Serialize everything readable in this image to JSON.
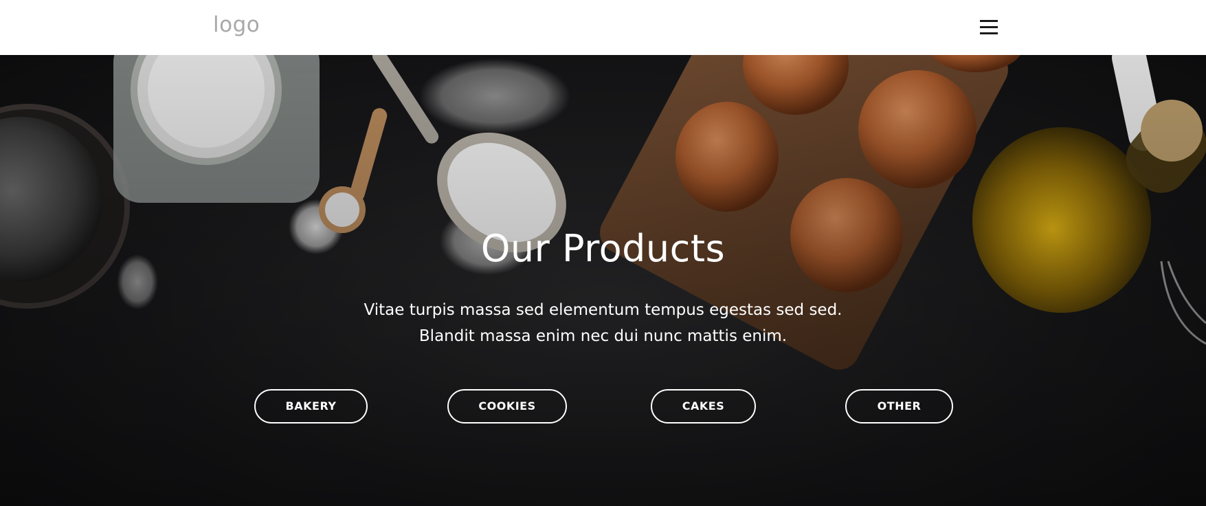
{
  "header": {
    "logo_text": "logo",
    "menu_icon": "hamburger-menu-icon"
  },
  "hero": {
    "title": "Our Products",
    "text_line_1": "Vitae turpis massa sed elementum tempus egestas sed sed.",
    "text_line_2": "Blandit massa enim nec dui nunc mattis enim.",
    "background_image": "baking-ingredients-photo"
  },
  "categories": {
    "bakery": "BAKERY",
    "cookies": "COOKIES",
    "cakes": "CAKES",
    "other": "OTHER"
  },
  "colors": {
    "header_bg": "#ffffff",
    "logo": "#a8a8a8",
    "hero_text": "#ffffff",
    "button_border": "#ffffff"
  }
}
